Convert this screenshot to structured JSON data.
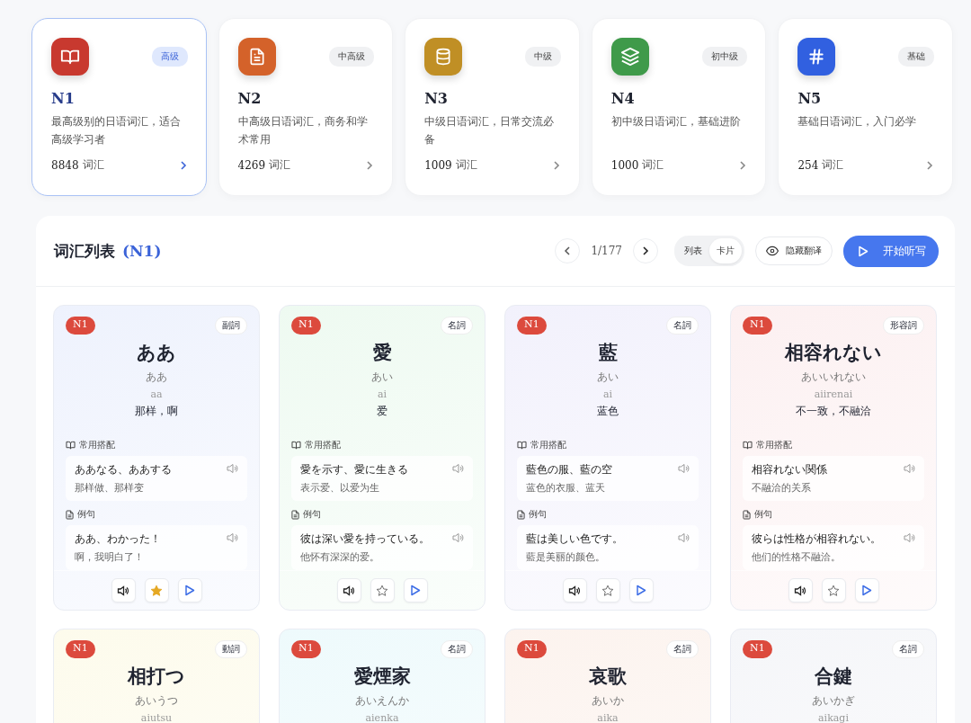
{
  "levels": [
    {
      "name": "N1",
      "badge": "高级",
      "description": "最高级别的日语词汇，适合高级学习者",
      "count": "8848",
      "unit": "词汇",
      "kind": "book",
      "color": "#c8392f",
      "selected": true
    },
    {
      "name": "N2",
      "badge": "中高级",
      "description": "中高级日语词汇，商务和学术常用",
      "count": "4269",
      "unit": "词汇",
      "kind": "document",
      "color": "#d4622a",
      "selected": false
    },
    {
      "name": "N3",
      "badge": "中级",
      "description": "中级日语词汇，日常交流必备",
      "count": "1009",
      "unit": "词汇",
      "kind": "database",
      "color": "#c08f25",
      "selected": false
    },
    {
      "name": "N4",
      "badge": "初中级",
      "description": "初中级日语词汇，基础进阶",
      "count": "1000",
      "unit": "词汇",
      "kind": "layers",
      "color": "#3f9a4a",
      "selected": false
    },
    {
      "name": "N5",
      "badge": "基础",
      "description": "基础日语词汇，入门必学",
      "count": "254",
      "unit": "词汇",
      "kind": "hash",
      "color": "#3160e0",
      "selected": false
    }
  ],
  "vocab": {
    "title": "词汇列表",
    "level_tag": "(N1)",
    "page": "1/177",
    "views": [
      {
        "label": "列表",
        "selected": false
      },
      {
        "label": "卡片",
        "selected": true
      }
    ],
    "hide_translation": "隐藏翻译",
    "dictation": "开始听写",
    "cards": [
      {
        "level": "N1",
        "pos": "副詞",
        "word": "ああ",
        "kana": "ああ",
        "romaji": "aa",
        "meaning": "那样，啊",
        "color": "#eef2fd",
        "collocation_label": "常用搭配",
        "collocation": {
          "jp": "ああなる、ああする",
          "cn": "那样做、那样变"
        },
        "example_label": "例句",
        "example": {
          "jp": "ああ、わかった！",
          "cn": "啊，我明白了！"
        },
        "favorite": true
      },
      {
        "level": "N1",
        "pos": "名詞",
        "word": "愛",
        "kana": "あい",
        "romaji": "ai",
        "meaning": "爱",
        "color": "#eefaf1",
        "collocation_label": "常用搭配",
        "collocation": {
          "jp": "愛を示す、愛に生きる",
          "cn": "表示爱、以爱为生"
        },
        "example_label": "例句",
        "example": {
          "jp": "彼は深い愛を持っている。",
          "cn": "他怀有深深的爱。"
        },
        "favorite": false
      },
      {
        "level": "N1",
        "pos": "名詞",
        "word": "藍",
        "kana": "あい",
        "romaji": "ai",
        "meaning": "蓝色",
        "color": "#f2f1fc",
        "collocation_label": "常用搭配",
        "collocation": {
          "jp": "藍色の服、藍の空",
          "cn": "蓝色的衣服、蓝天"
        },
        "example_label": "例句",
        "example": {
          "jp": "藍は美しい色です。",
          "cn": "藍是美丽的颜色。"
        },
        "favorite": false
      },
      {
        "level": "N1",
        "pos": "形容詞",
        "word": "相容れない",
        "kana": "あいいれない",
        "romaji": "aiirenai",
        "meaning": "不一致，不融洽",
        "color": "#fcf0f1",
        "collocation_label": "常用搭配",
        "collocation": {
          "jp": "相容れない関係",
          "cn": "不融洽的关系"
        },
        "example_label": "例句",
        "example": {
          "jp": "彼らは性格が相容れない。",
          "cn": "他们的性格不融洽。"
        },
        "favorite": false
      },
      {
        "level": "N1",
        "pos": "動詞",
        "word": "相打つ",
        "kana": "あいうつ",
        "romaji": "aiutsu",
        "color": "#fdfbec"
      },
      {
        "level": "N1",
        "pos": "名詞",
        "word": "愛煙家",
        "kana": "あいえんか",
        "romaji": "aienka",
        "color": "#eefafc"
      },
      {
        "level": "N1",
        "pos": "名詞",
        "word": "哀歌",
        "kana": "あいか",
        "romaji": "aika",
        "color": "#fcf3ee"
      },
      {
        "level": "N1",
        "pos": "名詞",
        "word": "合鍵",
        "kana": "あいかぎ",
        "romaji": "aikagi",
        "color": "#f5f6f9"
      }
    ]
  }
}
